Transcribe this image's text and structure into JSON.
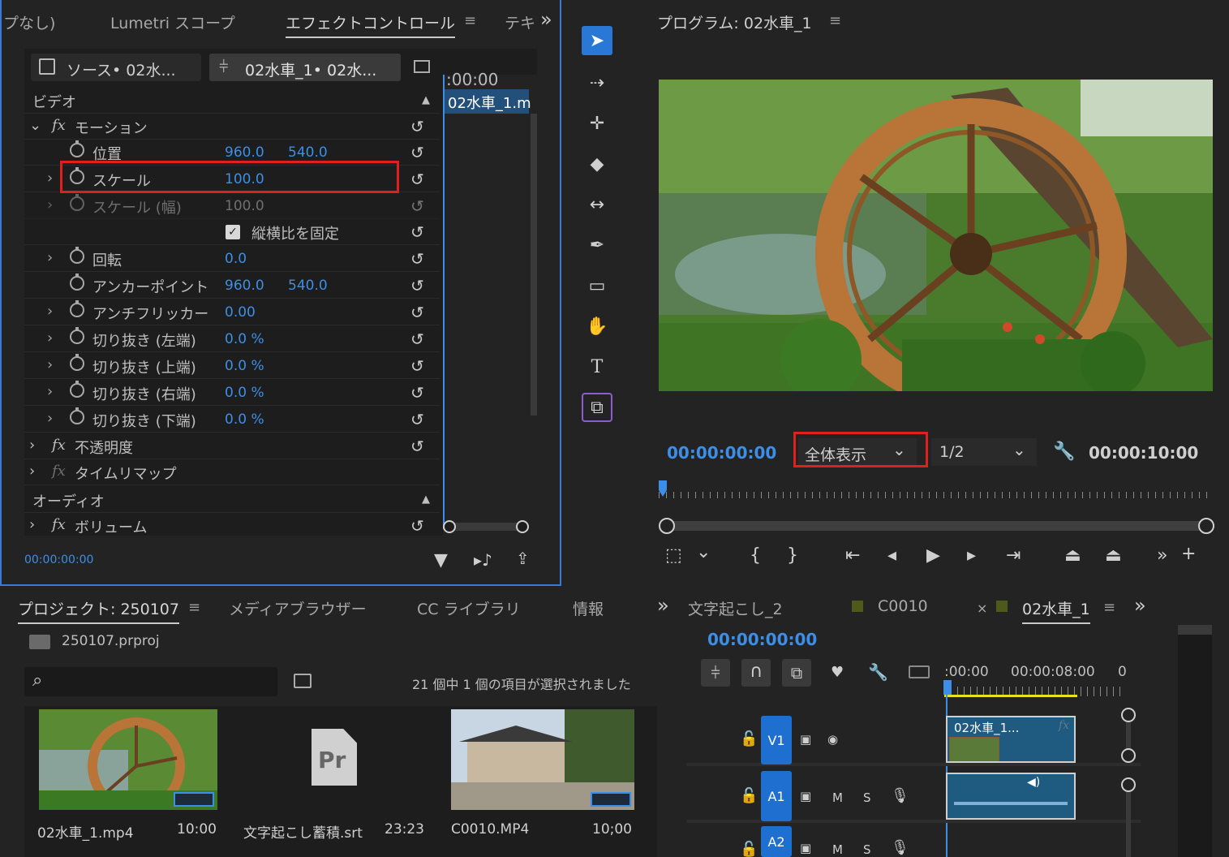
{
  "effect_panel": {
    "tabs": [
      "プなし)",
      "Lumetri スコープ",
      "エフェクトコントロール",
      "テキ"
    ],
    "menu_glyph": "≡",
    "more_glyph": "»",
    "source_tab": "ソース• 02水...",
    "seq_tab": "02水車_1• 02水...",
    "timecode_ruler": ":00:00",
    "clip_label": "02水車_1.m",
    "section_video": "ビデオ",
    "section_audio": "オーディオ",
    "motion": "モーション",
    "position_label": "位置",
    "position_x": "960.0",
    "position_y": "540.0",
    "scale_label": "スケール",
    "scale_value": "100.0",
    "scale_width_label": "スケール (幅)",
    "scale_width_value": "100.0",
    "uniform_label": "縦横比を固定",
    "rotation_label": "回転",
    "rotation_value": "0.0",
    "anchor_label": "アンカーポイント",
    "anchor_x": "960.0",
    "anchor_y": "540.0",
    "flicker_label": "アンチフリッカー",
    "flicker_value": "0.00",
    "crop_left_label": "切り抜き (左端)",
    "crop_left_value": "0.0 %",
    "crop_top_label": "切り抜き (上端)",
    "crop_top_value": "0.0 %",
    "crop_right_label": "切り抜き (右端)",
    "crop_right_value": "0.0 %",
    "crop_bottom_label": "切り抜き (下端)",
    "crop_bottom_value": "0.0 %",
    "opacity_label": "不透明度",
    "timeremap_label": "タイムリマップ",
    "volume_label": "ボリューム",
    "bottom_timecode": "00:00:00:00"
  },
  "program": {
    "title": "プログラム: 02水車_1",
    "current_time": "00:00:00:00",
    "zoom": "全体表示",
    "resolution": "1/2",
    "duration": "00:00:10:00"
  },
  "project": {
    "tabs": [
      "プロジェクト: 250107",
      "メディアブラウザー",
      "CC ライブラリ",
      "情報"
    ],
    "file": "250107.prproj",
    "search_placeholder": "",
    "selection_status": "21 個中 1 個の項目が選択されました",
    "items": [
      {
        "name": "02水車_1.mp4",
        "duration": "10:00"
      },
      {
        "name": "文字起こし蓄積.srt",
        "duration": "23:23"
      },
      {
        "name": "C0010.MP4",
        "duration": "10;00"
      }
    ],
    "pr_icon": "Pr"
  },
  "timeline": {
    "tabs": [
      "文字起こし_2",
      "C0010",
      "02水車_1"
    ],
    "close_glyph": "×",
    "timecode": "00:00:00:00",
    "ruler": [
      ":00:00",
      "00:00:08:00",
      "0"
    ],
    "tracks": [
      "V1",
      "A1",
      "A2"
    ],
    "mute": "M",
    "solo": "S",
    "clip_name": "02水車_1..."
  }
}
